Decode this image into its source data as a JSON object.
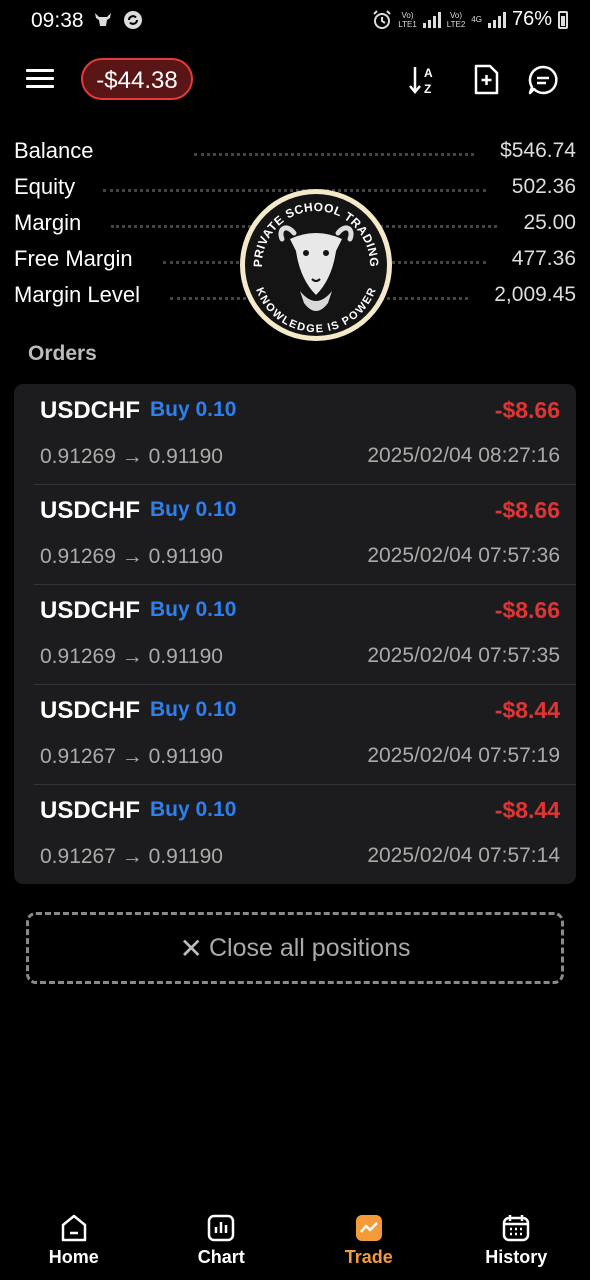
{
  "status_bar": {
    "time": "09:38",
    "battery": "76%",
    "sim1_label": "Vo)\nLTE1",
    "sim2_label": "Vo)\nLTE2",
    "sim2_extra": "4G"
  },
  "header": {
    "floating_pnl": "-$44.38",
    "icons": [
      "menu-icon",
      "sort-az-icon",
      "add-document-icon",
      "chat-icon"
    ]
  },
  "account": {
    "rows": [
      {
        "label": "Balance",
        "value": "$546.74"
      },
      {
        "label": "Equity",
        "value": "502.36"
      },
      {
        "label": "Margin",
        "value": "25.00"
      },
      {
        "label": "Free Margin",
        "value": "477.36"
      },
      {
        "label": "Margin Level",
        "value": "2,009.45"
      }
    ]
  },
  "watermark": {
    "top_text": "PRIVATE SCHOOL TRADING",
    "bottom_text": "KNOWLEDGE IS POWER"
  },
  "orders": {
    "heading": "Orders",
    "items": [
      {
        "symbol": "USDCHF",
        "side": "Buy 0.10",
        "profit": "-$8.66",
        "prices": "0.91269 → 0.91190",
        "time": "2025/02/04 08:27:16"
      },
      {
        "symbol": "USDCHF",
        "side": "Buy 0.10",
        "profit": "-$8.66",
        "prices": "0.91269 → 0.91190",
        "time": "2025/02/04 07:57:36"
      },
      {
        "symbol": "USDCHF",
        "side": "Buy 0.10",
        "profit": "-$8.66",
        "prices": "0.91269 → 0.91190",
        "time": "2025/02/04 07:57:35"
      },
      {
        "symbol": "USDCHF",
        "side": "Buy 0.10",
        "profit": "-$8.44",
        "prices": "0.91267 → 0.91190",
        "time": "2025/02/04 07:57:19"
      },
      {
        "symbol": "USDCHF",
        "side": "Buy 0.10",
        "profit": "-$8.44",
        "prices": "0.91267 → 0.91190",
        "time": "2025/02/04 07:57:14"
      }
    ]
  },
  "close_all": {
    "icon": "close-icon",
    "label": "Close all positions"
  },
  "bottom_nav": {
    "items": [
      {
        "label": "Home",
        "icon": "home-icon"
      },
      {
        "label": "Chart",
        "icon": "chart-icon"
      },
      {
        "label": "Trade",
        "icon": "trade-icon",
        "active": true
      },
      {
        "label": "History",
        "icon": "calendar-icon"
      }
    ]
  },
  "colors": {
    "background": "#000000",
    "loss": "#e03535",
    "buy": "#2f80ed",
    "active_tab": "#f39b38",
    "card": "#1c1c1e"
  }
}
